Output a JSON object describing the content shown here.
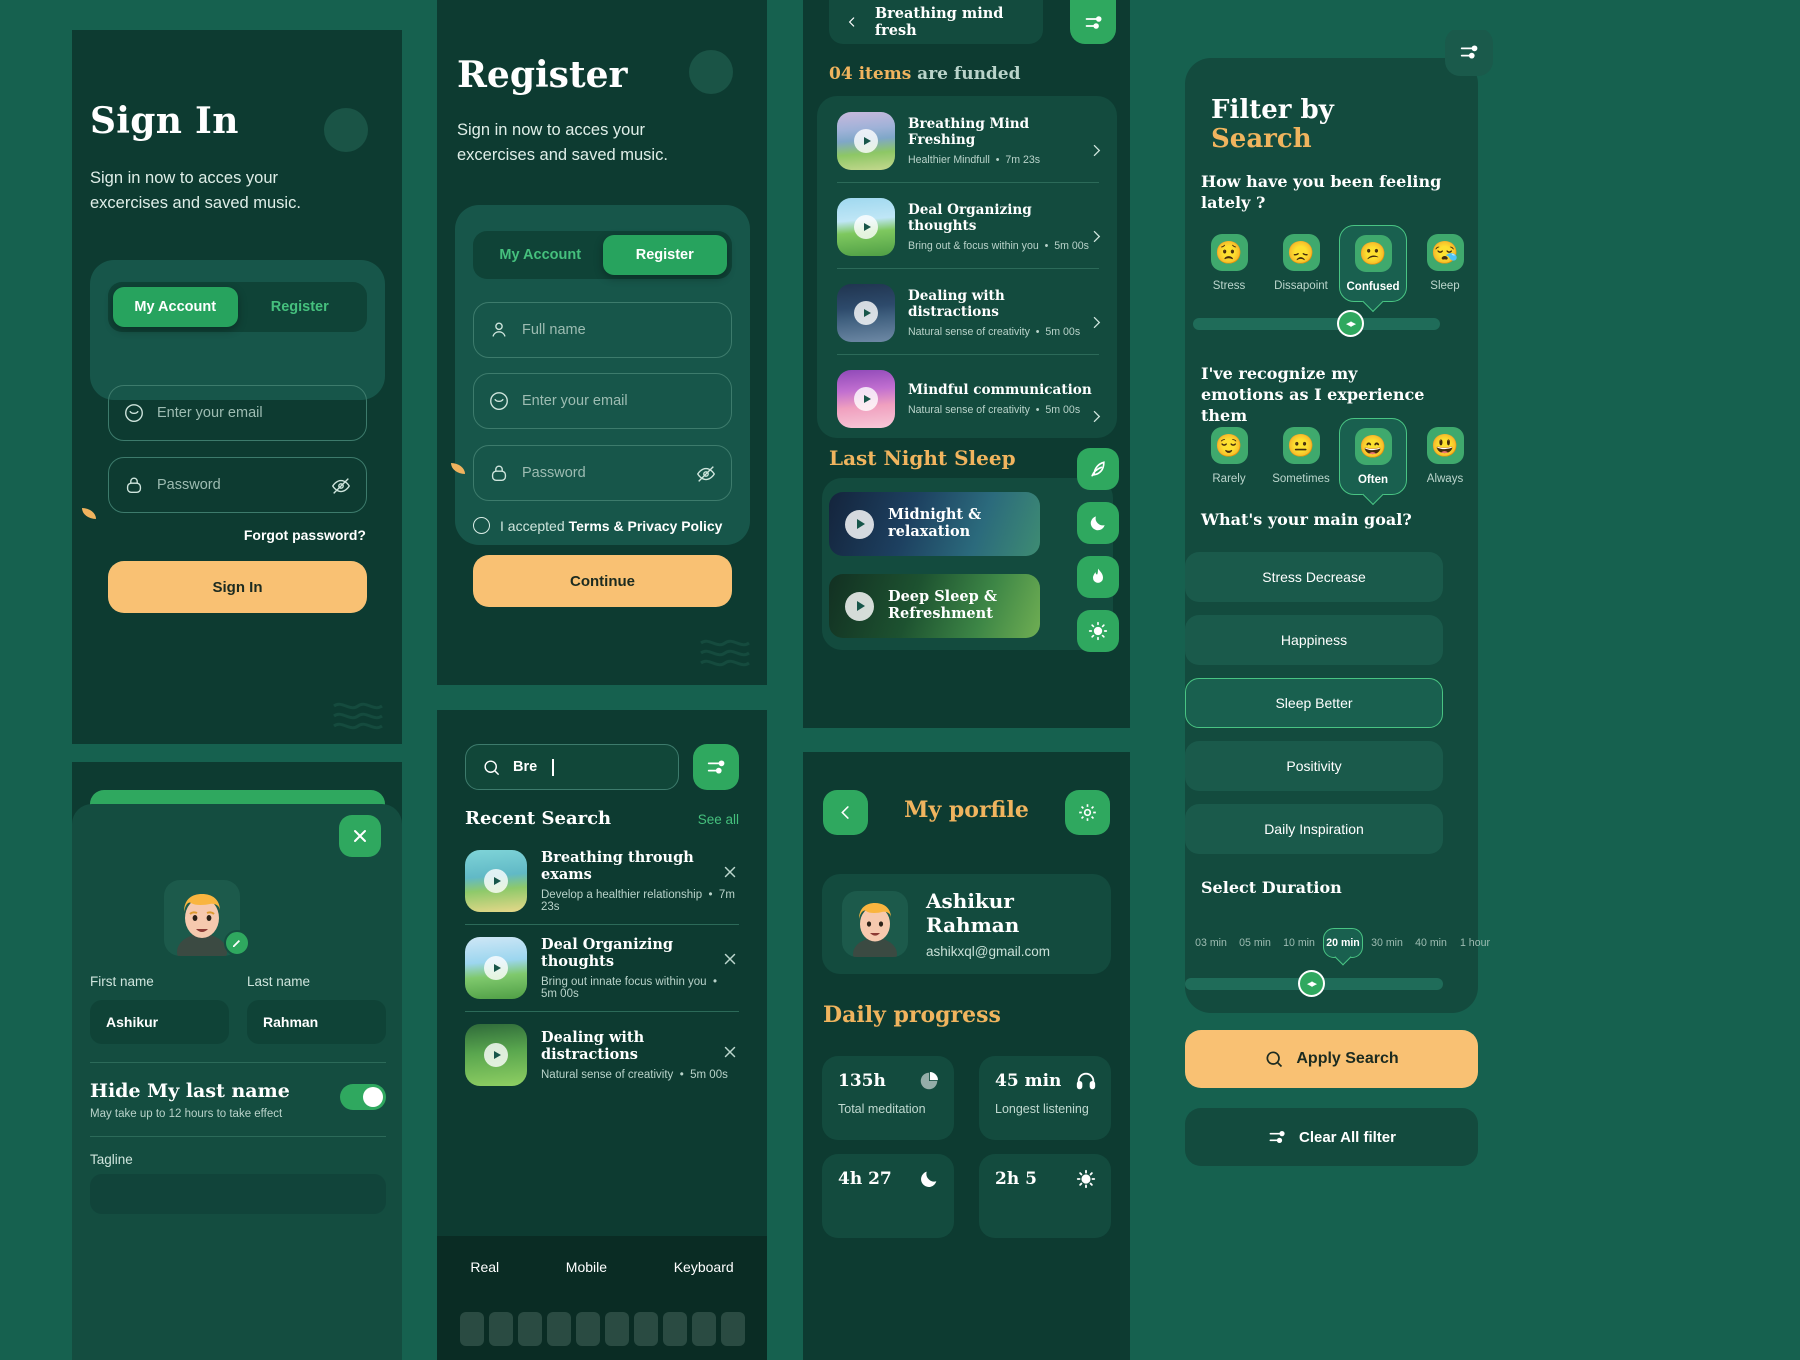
{
  "theme": {
    "bg": "#16614f",
    "panel": "#0d3b31",
    "card": "#134b3e",
    "green": "#2fa85f",
    "amber": "#f9c173",
    "gold": "#f0b45e",
    "muted": "#b9d3ca"
  },
  "signin": {
    "title": "Sign In",
    "subtitle": "Sign in now to acces your excercises and saved music.",
    "tabs": [
      {
        "label": "My Account",
        "active": true
      },
      {
        "label": "Register",
        "active": false
      }
    ],
    "email_placeholder": "Enter your email",
    "password_placeholder": "Password",
    "forgot": "Forgot password?",
    "submit": "Sign In"
  },
  "profile_edit": {
    "first_name_label": "First name",
    "last_name_label": "Last name",
    "first_name_value": "Ashikur",
    "last_name_value": "Rahman",
    "hide_title": "Hide My last name",
    "hide_sub": "May take up to 12 hours to take effect",
    "tagline_label": "Tagline",
    "toggle_on": true
  },
  "register": {
    "title": "Register",
    "subtitle": "Sign in now to acces your excercises and saved music.",
    "tabs": [
      {
        "label": "My Account",
        "active": false
      },
      {
        "label": "Register",
        "active": true
      }
    ],
    "fullname_placeholder": "Full name",
    "email_placeholder": "Enter your email",
    "password_placeholder": "Password",
    "terms_prefix": "I accepted ",
    "terms_link": "Terms & Privacy Policy",
    "submit": "Continue"
  },
  "search": {
    "query": "Bre",
    "recent_heading": "Recent Search",
    "see_all": "See all",
    "items": [
      {
        "title": "Breathing through exams",
        "sub": "Develop a healthier relationship",
        "time": "7m 23s"
      },
      {
        "title": "Deal Organizing thoughts",
        "sub": "Bring out innate focus within you",
        "time": "5m 00s"
      },
      {
        "title": "Dealing with distractions",
        "sub": "Natural sense of creativity",
        "time": "5m 00s"
      }
    ],
    "keyboard_tabs": [
      "Real",
      "Mobile",
      "Keyboard"
    ]
  },
  "breathing": {
    "back_title": "Breathing mind fresh",
    "funded_count": "04 items",
    "funded_rest": " are funded",
    "items": [
      {
        "title": "Breathing Mind Freshing",
        "sub": "Healthier Mindfull",
        "time": "7m 23s"
      },
      {
        "title": "Deal Organizing thoughts",
        "sub": "Bring out & focus within you",
        "time": "5m 00s"
      },
      {
        "title": "Dealing with distractions",
        "sub": "Natural sense of creativity",
        "time": "5m 00s"
      },
      {
        "title": "Mindful communication",
        "sub": "Natural sense of creativity",
        "time": "5m 00s"
      }
    ],
    "sleep_heading_a": "Last Night ",
    "sleep_heading_b": "Sleep",
    "sleep_cards": [
      {
        "title": "Midnight & relaxation"
      },
      {
        "title": "Deep Sleep & Refreshment"
      }
    ],
    "rail_icons": [
      "leaf-icon",
      "moon-icon",
      "flame-icon",
      "sun-icon"
    ]
  },
  "myprofile": {
    "title": "My porfile",
    "name": "Ashikur Rahman",
    "email": "ashikxql@gmail.com",
    "progress_heading_a": "Daily ",
    "progress_heading_b": "progress",
    "stats": [
      {
        "value": "135h",
        "label": "Total meditation",
        "icon": "pie-icon"
      },
      {
        "value": "45 min",
        "label": "Longest listening",
        "icon": "headphone-icon"
      },
      {
        "value": "4h 27",
        "label": "",
        "icon": "moon-icon"
      },
      {
        "value": "2h 5",
        "label": "",
        "icon": "sun-icon"
      }
    ]
  },
  "filter": {
    "title_a": "Filter by",
    "title_b": "Search",
    "question_mood": "How have you been feeling lately ?",
    "moods": [
      {
        "label": "Stress",
        "emoji": "😟",
        "selected": false
      },
      {
        "label": "Dissapoint",
        "emoji": "😞",
        "selected": false
      },
      {
        "label": "Confused",
        "emoji": "😕",
        "selected": true
      },
      {
        "label": "Sleep",
        "emoji": "😪",
        "selected": false
      }
    ],
    "question_freq": "I've recognize my emotions as I experience them",
    "frequency": [
      {
        "label": "Rarely",
        "emoji": "😌",
        "selected": false
      },
      {
        "label": "Sometimes",
        "emoji": "😐",
        "selected": false
      },
      {
        "label": "Often",
        "emoji": "😄",
        "selected": true
      },
      {
        "label": "Always",
        "emoji": "😃",
        "selected": false
      }
    ],
    "question_goal": "What's your main goal?",
    "goals": [
      {
        "label": "Stress Decrease",
        "selected": false
      },
      {
        "label": "Happiness",
        "selected": false
      },
      {
        "label": "Sleep Better",
        "selected": true
      },
      {
        "label": "Positivity",
        "selected": false
      },
      {
        "label": "Daily Inspiration",
        "selected": false
      }
    ],
    "duration_heading": "Select Duration",
    "durations": [
      {
        "label": "03 min",
        "selected": false
      },
      {
        "label": "05 min",
        "selected": false
      },
      {
        "label": "10 min",
        "selected": false
      },
      {
        "label": "20 min",
        "selected": true
      },
      {
        "label": "30 min",
        "selected": false
      },
      {
        "label": "40 min",
        "selected": false
      },
      {
        "label": "1 hour",
        "selected": false
      }
    ],
    "apply_label": "Apply Search",
    "clear_label": "Clear All filter"
  }
}
